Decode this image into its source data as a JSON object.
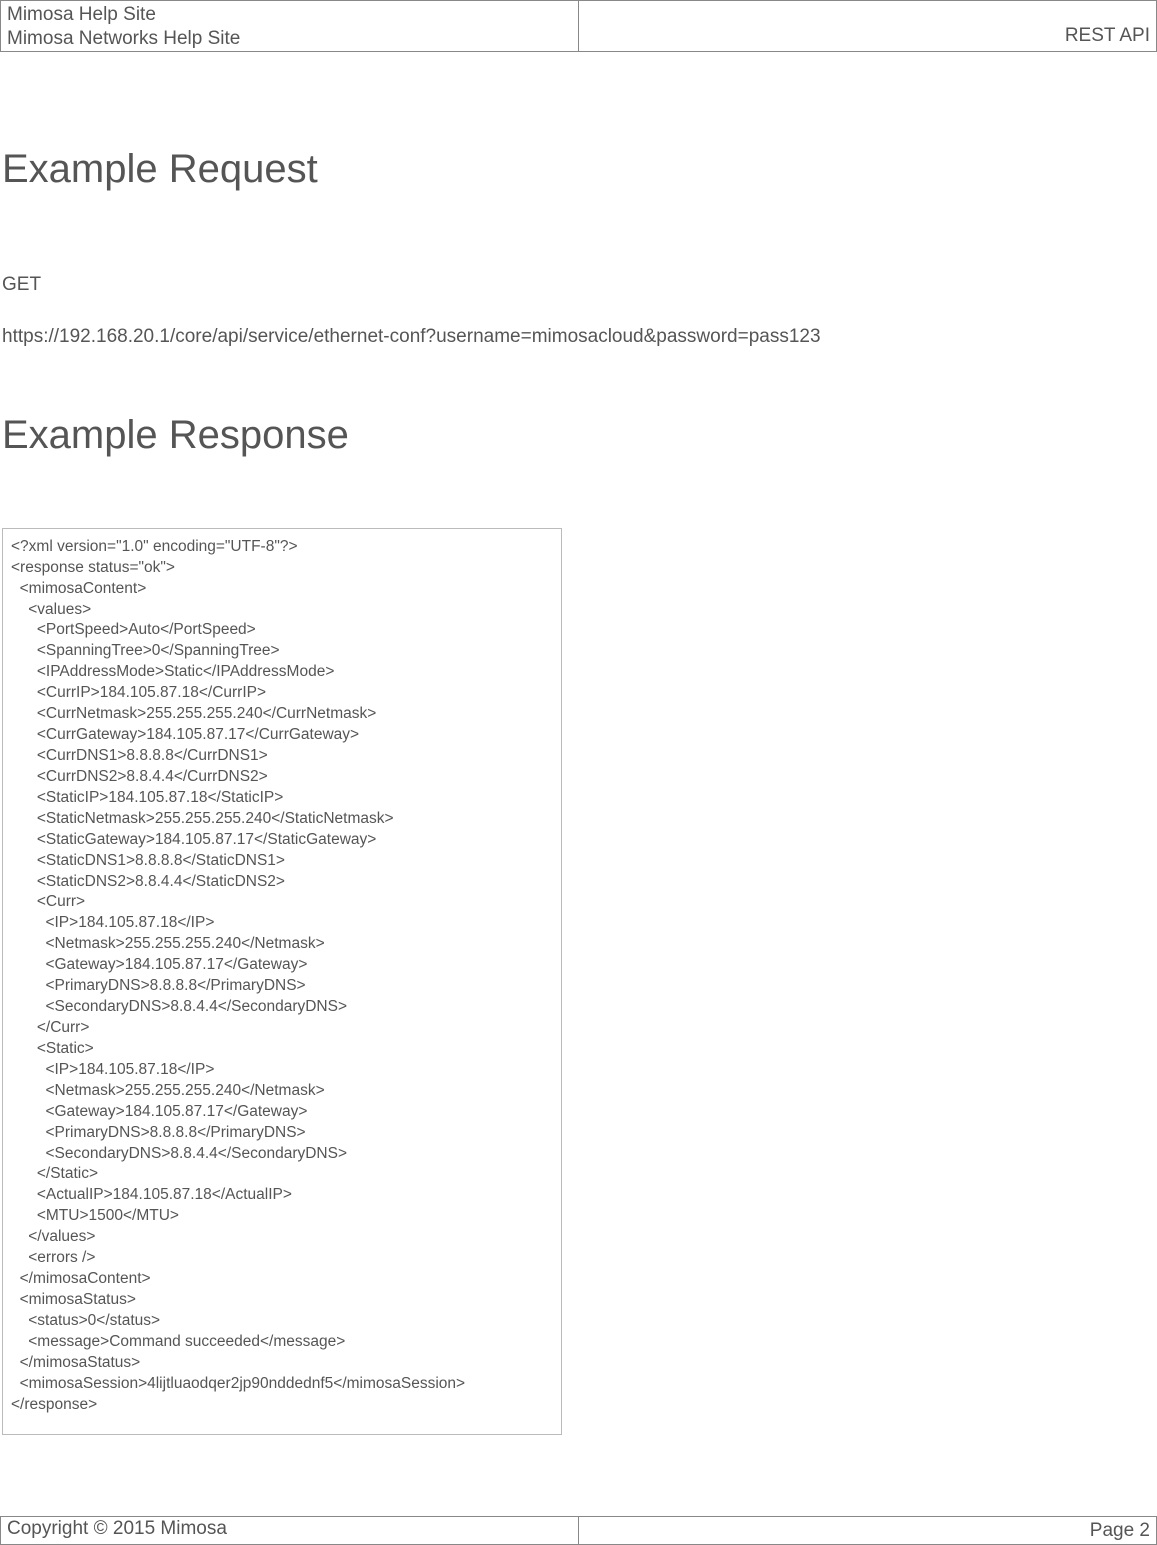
{
  "header": {
    "title_line1": "Mimosa Help Site",
    "title_line2": "Mimosa Networks Help Site",
    "right_label": "REST API"
  },
  "section1": {
    "heading": "Example Request",
    "method": "GET",
    "url": "https://192.168.20.1/core/api/service/ethernet-conf?username=mimosacloud&password=pass123"
  },
  "section2": {
    "heading": "Example Response",
    "code": "<?xml version=\"1.0\" encoding=\"UTF-8\"?>\n<response status=\"ok\">\n  <mimosaContent>\n    <values>\n      <PortSpeed>Auto</PortSpeed>\n      <SpanningTree>0</SpanningTree>\n      <IPAddressMode>Static</IPAddressMode>\n      <CurrIP>184.105.87.18</CurrIP>\n      <CurrNetmask>255.255.255.240</CurrNetmask>\n      <CurrGateway>184.105.87.17</CurrGateway>\n      <CurrDNS1>8.8.8.8</CurrDNS1>\n      <CurrDNS2>8.8.4.4</CurrDNS2>\n      <StaticIP>184.105.87.18</StaticIP>\n      <StaticNetmask>255.255.255.240</StaticNetmask>\n      <StaticGateway>184.105.87.17</StaticGateway>\n      <StaticDNS1>8.8.8.8</StaticDNS1>\n      <StaticDNS2>8.8.4.4</StaticDNS2>\n      <Curr>\n        <IP>184.105.87.18</IP>\n        <Netmask>255.255.255.240</Netmask>\n        <Gateway>184.105.87.17</Gateway>\n        <PrimaryDNS>8.8.8.8</PrimaryDNS>\n        <SecondaryDNS>8.8.4.4</SecondaryDNS>\n      </Curr>\n      <Static>\n        <IP>184.105.87.18</IP>\n        <Netmask>255.255.255.240</Netmask>\n        <Gateway>184.105.87.17</Gateway>\n        <PrimaryDNS>8.8.8.8</PrimaryDNS>\n        <SecondaryDNS>8.8.4.4</SecondaryDNS>\n      </Static>\n      <ActualIP>184.105.87.18</ActualIP>\n      <MTU>1500</MTU>\n    </values>\n    <errors />\n  </mimosaContent>\n  <mimosaStatus>\n    <status>0</status>\n    <message>Command succeeded</message>\n  </mimosaStatus>\n  <mimosaSession>4lijtluaodqer2jp90nddednf5</mimosaSession>\n</response>"
  },
  "footer": {
    "copyright": "Copyright © 2015 Mimosa",
    "page_label": "Page 2"
  }
}
